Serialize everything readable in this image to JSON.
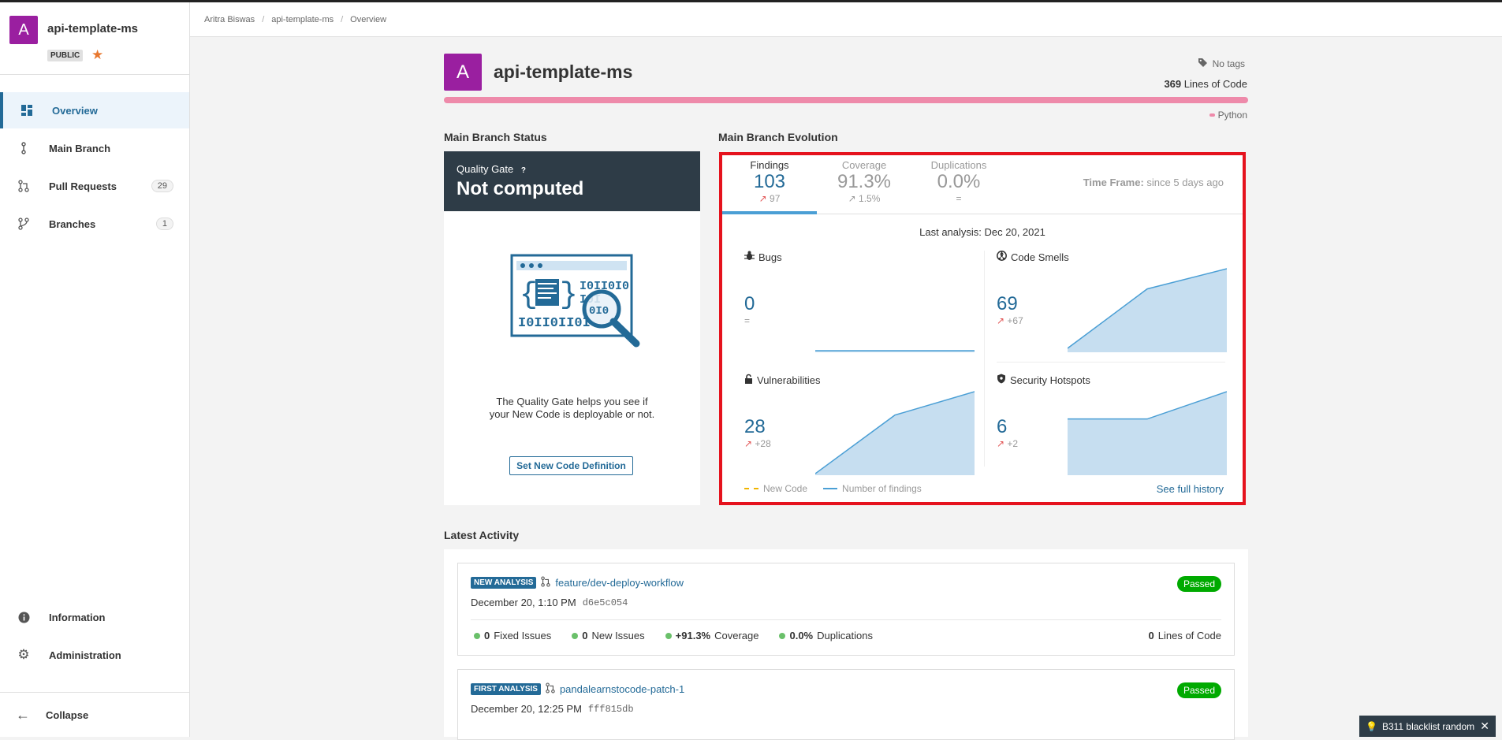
{
  "sidebar": {
    "avatar_letter": "A",
    "project_name": "api-template-ms",
    "visibility": "PUBLIC",
    "items": [
      {
        "label": "Overview",
        "icon": "dashboard-icon"
      },
      {
        "label": "Main Branch",
        "icon": "branch-line-icon"
      },
      {
        "label": "Pull Requests",
        "icon": "pull-request-icon",
        "count": "29"
      },
      {
        "label": "Branches",
        "icon": "branches-icon",
        "count": "1"
      }
    ],
    "bottom_items": [
      {
        "label": "Information",
        "icon": "info-icon"
      },
      {
        "label": "Administration",
        "icon": "gear-icon"
      }
    ],
    "collapse_label": "Collapse"
  },
  "breadcrumb": [
    "Aritra Biswas",
    "api-template-ms",
    "Overview"
  ],
  "header": {
    "avatar_letter": "A",
    "title": "api-template-ms",
    "tags": "No tags",
    "loc_value": "369",
    "loc_label": "Lines of Code",
    "language": "Python",
    "language_color": "#ee8aaa"
  },
  "quality_gate": {
    "section_title": "Main Branch Status",
    "label": "Quality Gate",
    "help": "?",
    "status": "Not computed",
    "text_line1": "The Quality Gate helps you see if",
    "text_line2": "your New Code is deployable or not.",
    "button": "Set New Code Definition"
  },
  "evolution": {
    "section_title": "Main Branch Evolution",
    "tabs": [
      {
        "name": "Findings",
        "value": "103",
        "delta": "97"
      },
      {
        "name": "Coverage",
        "value": "91.3%",
        "delta": "1.5%"
      },
      {
        "name": "Duplications",
        "value": "0.0%",
        "delta": "="
      }
    ],
    "timeframe_label": "Time Frame:",
    "timeframe_value": "since 5 days ago",
    "last_analysis": "Last analysis: Dec 20, 2021",
    "cells": [
      {
        "name": "Bugs",
        "icon": "bug-icon",
        "value": "0",
        "delta": "=",
        "trend": [
          0,
          0,
          0
        ]
      },
      {
        "name": "Code Smells",
        "icon": "code-smell-icon",
        "value": "69",
        "delta": "+67",
        "trend": [
          2,
          52,
          69
        ]
      },
      {
        "name": "Vulnerabilities",
        "icon": "lock-icon",
        "value": "28",
        "delta": "+28",
        "trend": [
          0,
          20,
          28
        ]
      },
      {
        "name": "Security Hotspots",
        "icon": "shield-icon",
        "value": "6",
        "delta": "+2",
        "trend": [
          4,
          4,
          6
        ]
      }
    ],
    "legend_new_code": "New Code",
    "legend_findings": "Number of findings",
    "see_history": "See full history",
    "accent": "#4b9fd5"
  },
  "activity": {
    "section_title": "Latest Activity",
    "entries": [
      {
        "tag": "NEW ANALYSIS",
        "branch": "feature/dev-deploy-workflow",
        "date": "December 20, 1:10 PM",
        "commit": "d6e5c054",
        "status": "Passed",
        "fixed_value": "0",
        "fixed_label": "Fixed Issues",
        "new_value": "0",
        "new_label": "New Issues",
        "cov_value": "+91.3%",
        "cov_label": "Coverage",
        "dup_value": "0.0%",
        "dup_label": "Duplications",
        "loc_value": "0",
        "loc_label": "Lines of Code"
      },
      {
        "tag": "FIRST ANALYSIS",
        "branch": "pandalearnstocode-patch-1",
        "date": "December 20, 12:25 PM",
        "commit": "fff815db",
        "status": "Passed"
      }
    ]
  },
  "toast": {
    "text": "B311 blacklist random"
  }
}
